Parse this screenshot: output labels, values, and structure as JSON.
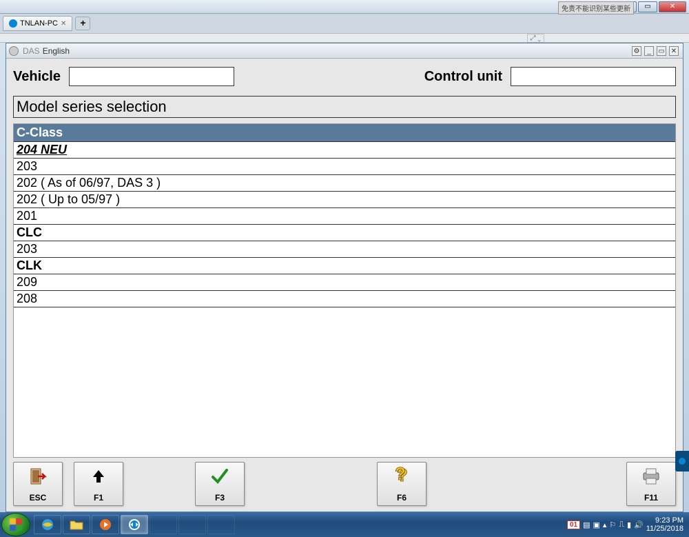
{
  "outer_window": {
    "tab_title": "TNLAN-PC",
    "lang_hint": "免责不能识别某些更新"
  },
  "das": {
    "title_prefix": "DAS",
    "language": "English"
  },
  "header": {
    "vehicle_label": "Vehicle",
    "vehicle_value": "",
    "control_unit_label": "Control unit",
    "control_unit_value": ""
  },
  "section_title": "Model series selection",
  "list": {
    "header": "C-Class",
    "rows": [
      {
        "text": "204 NEU",
        "type": "selected"
      },
      {
        "text": "203",
        "type": "normal"
      },
      {
        "text": "202 ( As of 06/97, DAS 3 )",
        "type": "normal"
      },
      {
        "text": "202 ( Up to 05/97 )",
        "type": "normal"
      },
      {
        "text": "201",
        "type": "normal"
      },
      {
        "text": "CLC",
        "type": "group"
      },
      {
        "text": "203",
        "type": "normal"
      },
      {
        "text": "CLK",
        "type": "group"
      },
      {
        "text": "209",
        "type": "normal"
      },
      {
        "text": "208",
        "type": "normal"
      }
    ]
  },
  "fn_keys": {
    "esc": "ESC",
    "f1": "F1",
    "f3": "F3",
    "f6": "F6",
    "f11": "F11"
  },
  "tray": {
    "lang": "01",
    "time": "9:23 PM",
    "date": "11/25/2018"
  }
}
